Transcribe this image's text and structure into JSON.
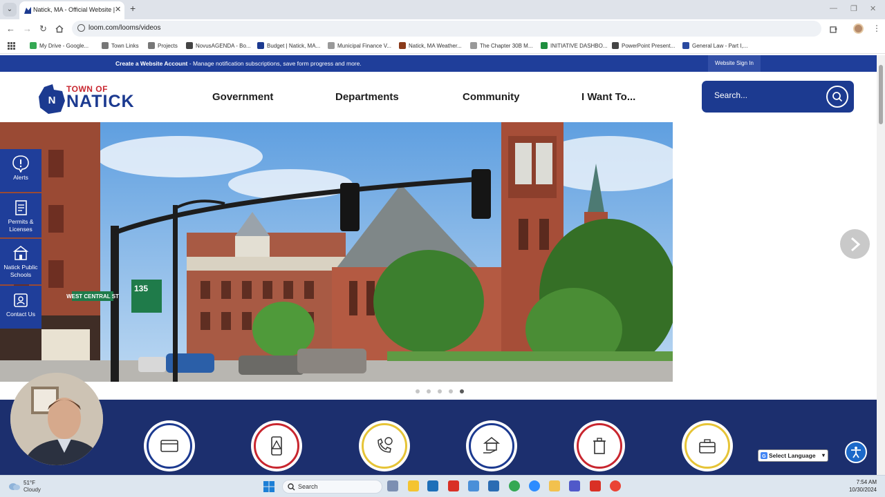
{
  "browser": {
    "tab_title": "Natick, MA - Official Website | O",
    "url": "loom.com/looms/videos",
    "bookmarks": [
      {
        "label": "My Drive - Google...",
        "color": "#34a853"
      },
      {
        "label": "Town Links",
        "color": "#777777"
      },
      {
        "label": "Projects",
        "color": "#777777"
      },
      {
        "label": "NovusAGENDA - Bo...",
        "color": "#444444"
      },
      {
        "label": "Budget | Natick, MA...",
        "color": "#1c3a90"
      },
      {
        "label": "Municipal Finance V...",
        "color": "#999999"
      },
      {
        "label": "Natick, MA Weather...",
        "color": "#8a3a1a"
      },
      {
        "label": "The Chapter 30B M...",
        "color": "#999999"
      },
      {
        "label": "INITIATIVE DASHBO...",
        "color": "#1e8e3e"
      },
      {
        "label": "PowerPoint Present...",
        "color": "#444444"
      },
      {
        "label": "General Law - Part I,...",
        "color": "#2a4aa0"
      }
    ]
  },
  "site": {
    "banner": {
      "bold": "Create a Website Account",
      "rest": " - Manage notification subscriptions, save form progress and more."
    },
    "signin_label": "Website Sign In",
    "logo": {
      "town_of": "TOWN OF",
      "name": "NATICK"
    },
    "nav": [
      "Government",
      "Departments",
      "Community",
      "I Want To..."
    ],
    "search_placeholder": "Search...",
    "side_links": [
      "Alerts",
      "Permits & Licenses",
      "Natick Public Schools",
      "Contact Us"
    ],
    "street_sign": "WEST CENTRAL ST",
    "route_sign": "135",
    "slider": {
      "total": 5,
      "active": 5
    },
    "language_label": "Select Language"
  },
  "taskbar": {
    "temp": "51°F",
    "condition": "Cloudy",
    "search_label": "Search",
    "time": "7:54 AM",
    "date": "10/30/2024"
  },
  "colors": {
    "brand_blue": "#1c3a90",
    "brand_red": "#c8262f",
    "gold": "#e6c437"
  }
}
